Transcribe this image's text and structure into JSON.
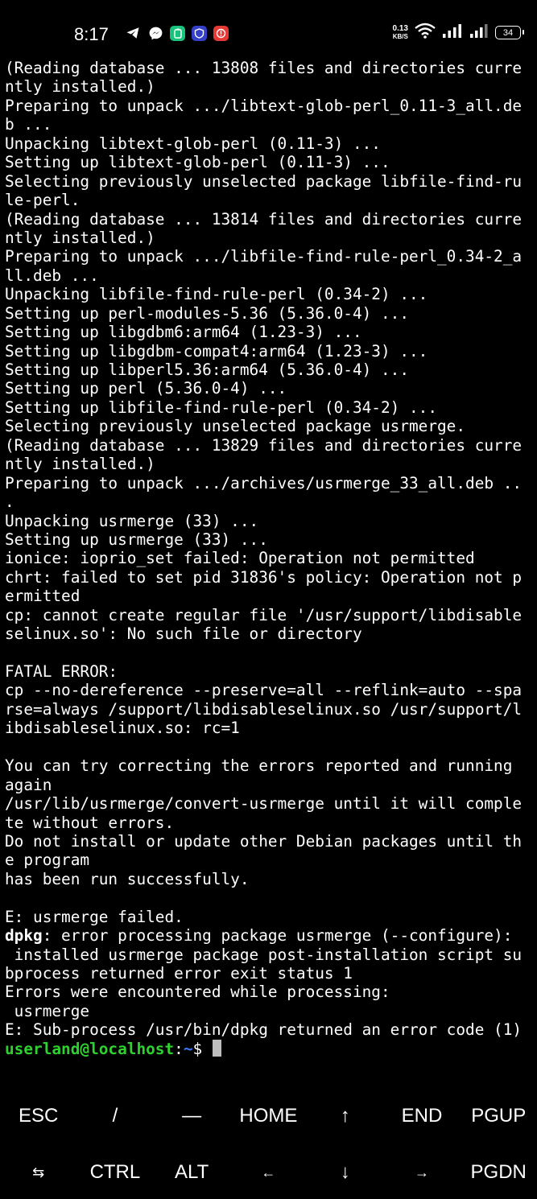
{
  "status_bar": {
    "time": "8:17",
    "net_speed_value": "0.13",
    "net_speed_unit": "KB/S",
    "battery": "34"
  },
  "terminal": {
    "lines": [
      "(Reading database ... 13808 files and directories curre",
      "ntly installed.)",
      "Preparing to unpack .../libtext-glob-perl_0.11-3_all.de",
      "b ...",
      "Unpacking libtext-glob-perl (0.11-3) ...",
      "Setting up libtext-glob-perl (0.11-3) ...",
      "Selecting previously unselected package libfile-find-ru",
      "le-perl.",
      "(Reading database ... 13814 files and directories curre",
      "ntly installed.)",
      "Preparing to unpack .../libfile-find-rule-perl_0.34-2_a",
      "ll.deb ...",
      "Unpacking libfile-find-rule-perl (0.34-2) ...",
      "Setting up perl-modules-5.36 (5.36.0-4) ...",
      "Setting up libgdbm6:arm64 (1.23-3) ...",
      "Setting up libgdbm-compat4:arm64 (1.23-3) ...",
      "Setting up libperl5.36:arm64 (5.36.0-4) ...",
      "Setting up perl (5.36.0-4) ...",
      "Setting up libfile-find-rule-perl (0.34-2) ...",
      "Selecting previously unselected package usrmerge.",
      "(Reading database ... 13829 files and directories curre",
      "ntly installed.)",
      "Preparing to unpack .../archives/usrmerge_33_all.deb ..",
      ".",
      "Unpacking usrmerge (33) ...",
      "Setting up usrmerge (33) ...",
      "ionice: ioprio_set failed: Operation not permitted",
      "chrt: failed to set pid 31836's policy: Operation not p",
      "ermitted",
      "cp: cannot create regular file '/usr/support/libdisable",
      "selinux.so': No such file or directory",
      "",
      "FATAL ERROR:",
      "cp --no-dereference --preserve=all --reflink=auto --spa",
      "rse=always /support/libdisableselinux.so /usr/support/l",
      "ibdisableselinux.so: rc=1",
      "",
      "You can try correcting the errors reported and running",
      "again",
      "/usr/lib/usrmerge/convert-usrmerge until it will comple",
      "te without errors.",
      "Do not install or update other Debian packages until th",
      "e program",
      "has been run successfully.",
      "",
      "E: usrmerge failed."
    ],
    "dpkg_prefix": "dpkg",
    "dpkg_rest": ": error processing package usrmerge (--configure):",
    "lines_after": [
      " installed usrmerge package post-installation script su",
      "bprocess returned error exit status 1",
      "Errors were encountered while processing:",
      " usrmerge",
      "E: Sub-process /usr/bin/dpkg returned an error code (1)"
    ],
    "prompt_user": "userland@localhost",
    "prompt_colon": ":",
    "prompt_path": "~",
    "prompt_symbol": "$ "
  },
  "extra_keys": {
    "row1": [
      "ESC",
      "/",
      "—",
      "HOME",
      "↑",
      "END",
      "PGUP"
    ],
    "row2": [
      "⇆",
      "CTRL",
      "ALT",
      "←",
      "↓",
      "→",
      "PGDN"
    ]
  },
  "colors": {
    "background": "#000000",
    "prompt_user": "#2fd12f",
    "prompt_path": "#3b78ff"
  }
}
